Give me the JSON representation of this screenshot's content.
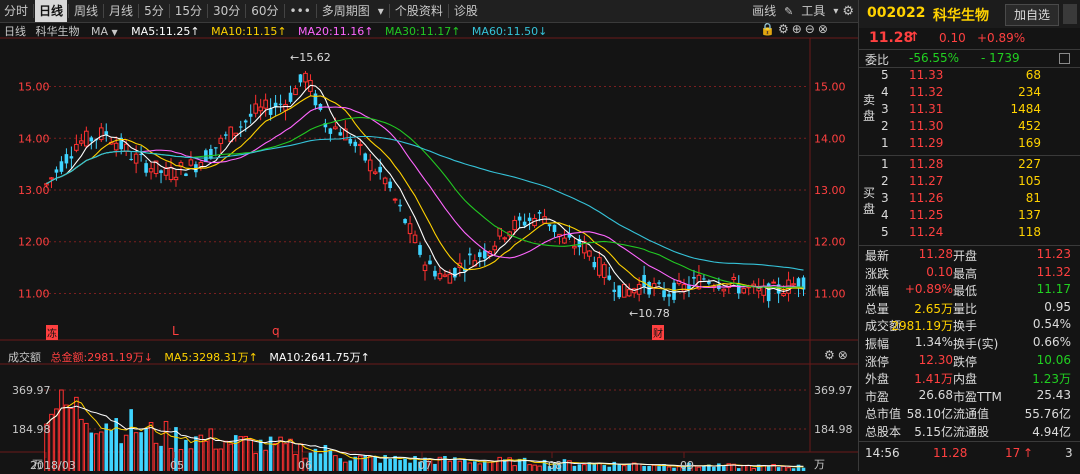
{
  "toolbar": {
    "items": [
      "分时",
      "日线",
      "周线",
      "月线",
      "5分",
      "15分",
      "30分",
      "60分",
      "•••",
      "多周期图",
      "▾",
      "个股资料",
      "诊股"
    ],
    "active_index": 1,
    "right": [
      "画线",
      "工具",
      "▾"
    ]
  },
  "price_indicator": {
    "period": "日线",
    "name": "科华生物",
    "ma_label": "MA",
    "ma5": "MA5:11.25↑",
    "ma10": "MA10:11.15↑",
    "ma20": "MA20:11.16↑",
    "ma30": "MA30:11.17↑",
    "ma60": "MA60:11.50↓"
  },
  "colors": {
    "up": "#ff3030",
    "down": "#3fd4ff",
    "ma5": "#ffffff",
    "ma10": "#ffd200",
    "ma20": "#ff66ff",
    "ma30": "#22c922",
    "ma60": "#35c2d8",
    "grid": "#7a1f1f",
    "axis_text": "#ff4040"
  },
  "price_axis": {
    "ticks": [
      "15.00",
      "14.00",
      "13.00",
      "12.00",
      "11.00"
    ],
    "values": [
      15,
      14,
      13,
      12,
      11
    ],
    "range": [
      10.1,
      15.9
    ]
  },
  "annotations": {
    "high": "15.62",
    "low": "10.78",
    "marker_1": "冻",
    "marker_2": "L",
    "marker_3": "q",
    "marker_4": "财"
  },
  "volume_indicator": {
    "title": "成交额",
    "total": "总金额:2981.19万↓",
    "ma5": "MA5:3298.31万↑",
    "ma10": "MA10:2641.75万↑"
  },
  "volume_axis": {
    "ticks": [
      "369.97",
      "184.98",
      "万"
    ]
  },
  "time_axis": {
    "labels": [
      "2018/03",
      "05",
      "06",
      "07",
      "08",
      "09"
    ]
  },
  "panel": {
    "code": "002022",
    "name": "科华生物",
    "add_button": "加自选",
    "price": "11.28",
    "price_arrow": "↑",
    "change": "0.10",
    "change_pct": "+0.89%",
    "weibi_label": "委比",
    "weibi_value": "-56.55%",
    "weicha_value": "- 1739",
    "sell_label": "卖盘",
    "buy_label": "买盘",
    "sell": [
      {
        "level": "5",
        "price": "11.33",
        "vol": "68"
      },
      {
        "level": "4",
        "price": "11.32",
        "vol": "234"
      },
      {
        "level": "3",
        "price": "11.31",
        "vol": "1484"
      },
      {
        "level": "2",
        "price": "11.30",
        "vol": "452"
      },
      {
        "level": "1",
        "price": "11.29",
        "vol": "169"
      }
    ],
    "buy": [
      {
        "level": "1",
        "price": "11.28",
        "vol": "227"
      },
      {
        "level": "2",
        "price": "11.27",
        "vol": "105"
      },
      {
        "level": "3",
        "price": "11.26",
        "vol": "81"
      },
      {
        "level": "4",
        "price": "11.25",
        "vol": "137"
      },
      {
        "level": "5",
        "price": "11.24",
        "vol": "118"
      }
    ],
    "stats": [
      {
        "l1": "最新",
        "v1": "11.28",
        "c1": "red",
        "l2": "开盘",
        "v2": "11.23",
        "c2": "red"
      },
      {
        "l1": "涨跌",
        "v1": "0.10",
        "c1": "red",
        "l2": "最高",
        "v2": "11.32",
        "c2": "red"
      },
      {
        "l1": "涨幅",
        "v1": "+0.89%",
        "c1": "red",
        "l2": "最低",
        "v2": "11.17",
        "c2": "green"
      },
      {
        "l1": "总量",
        "v1": "2.65万",
        "c1": "yellow",
        "l2": "量比",
        "v2": "0.95",
        "c2": "white"
      },
      {
        "l1": "成交额",
        "v1": "2981.19万",
        "c1": "yellow",
        "l2": "换手",
        "v2": "0.54%",
        "c2": "white"
      },
      {
        "l1": "振幅",
        "v1": "1.34%",
        "c1": "white",
        "l2": "换手(实)",
        "v2": "0.66%",
        "c2": "white"
      },
      {
        "l1": "涨停",
        "v1": "12.30",
        "c1": "red",
        "l2": "跌停",
        "v2": "10.06",
        "c2": "green"
      },
      {
        "l1": "外盘",
        "v1": "1.41万",
        "c1": "red",
        "l2": "内盘",
        "v2": "1.23万",
        "c2": "green"
      },
      {
        "l1": "市盈",
        "v1": "26.68",
        "c1": "white",
        "l2": "市盈TTM",
        "v2": "25.43",
        "c2": "white"
      },
      {
        "l1": "总市值",
        "v1": "58.10亿",
        "c1": "white",
        "l2": "流通值",
        "v2": "55.76亿",
        "c2": "white"
      },
      {
        "l1": "总股本",
        "v1": "5.15亿",
        "c1": "white",
        "l2": "流通股",
        "v2": "4.94亿",
        "c2": "white"
      }
    ],
    "tick": {
      "time": "14:56",
      "price": "11.28",
      "vol": "17",
      "arrow": "↑",
      "count": "3"
    }
  }
}
